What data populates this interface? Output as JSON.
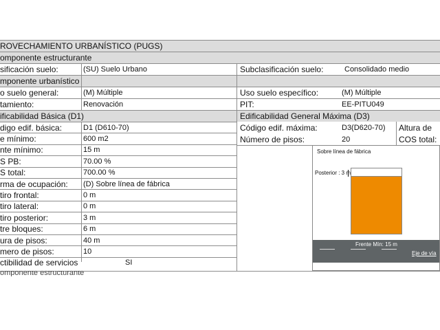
{
  "section_title": "ROVECHAMIENTO URBANÍSTICO (PUGS)",
  "structural_component": {
    "title": "omponente  estructurante",
    "classification_label": "sificación suelo:",
    "classification_value": "(SU) Suelo Urbano",
    "subclassification_label": "Subclasificación suelo:",
    "subclassification_value": "Consolidado medio"
  },
  "urban_component": {
    "title": "mponente  urbanístico",
    "general_use_label": "o suelo general:",
    "general_use_value": "(M) Múltiple",
    "specific_use_label": "Uso suelo específico:",
    "specific_use_value": "(M) Múltiple",
    "treatment_label": "tamiento:",
    "treatment_value": "Renovación",
    "pit_label": "PIT:",
    "pit_value": "EE-PITU049"
  },
  "basic_buildability": {
    "title": "ificabilidad Básica (D1)",
    "rows": [
      {
        "label": "digo edif. básica:",
        "value": "D1 (D610-70)"
      },
      {
        "label": "e mínimo:",
        "value": "600 m2"
      },
      {
        "label": "nte mínimo:",
        "value": "15 m"
      },
      {
        "label": "S PB:",
        "value": "70.00 %"
      },
      {
        "label": "S total:",
        "value": "700.00 %"
      },
      {
        "label": "rma de ocupación:",
        "value": "(D) Sobre línea de fábrica"
      },
      {
        "label": "tiro frontal:",
        "value": "0 m"
      },
      {
        "label": "tiro lateral:",
        "value": "0 m"
      },
      {
        "label": "tiro posterior:",
        "value": "3 m"
      },
      {
        "label": "tre bloques:",
        "value": "6 m"
      },
      {
        "label": "ura de pisos:",
        "value": "40 m"
      },
      {
        "label": "mero de pisos:",
        "value": "10"
      },
      {
        "label": "ctibilidad de servicios",
        "value": "SI"
      }
    ]
  },
  "general_buildability": {
    "title": "Edificabilidad General Máxima (D3)",
    "code_label": "Código edif. máxima:",
    "code_value": "D3(D620-70)",
    "height_label": "Altura de",
    "floors_label": "Número de pisos:",
    "floors_value": "20",
    "cos_label": "COS total:"
  },
  "diagram": {
    "title": "Sobre línea de fábrica",
    "posterior_label": "Posterior : 3 m",
    "front_label": "Frente Mín: 15 m",
    "axis_label": "Eje de vía",
    "colors": {
      "building": "#ee8a00",
      "road": "#5f6466",
      "line": "#ffffff"
    }
  },
  "cutoff_text": "omponente  estructurante"
}
